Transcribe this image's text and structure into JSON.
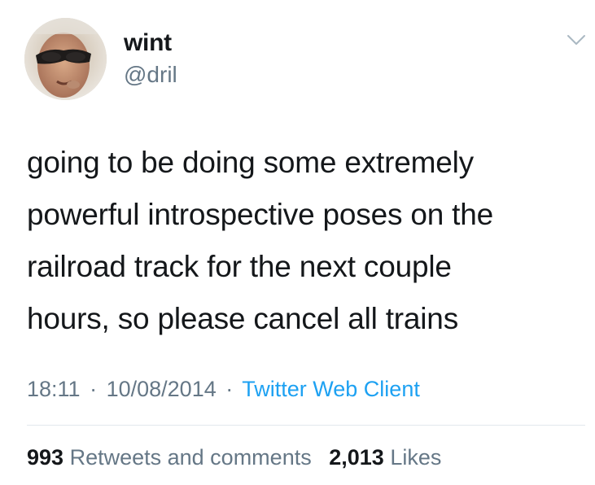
{
  "user": {
    "display_name": "wint",
    "handle": "@dril"
  },
  "tweet": {
    "lines": [
      "going to be doing some extremely",
      "powerful introspective poses on the",
      "railroad track for the next couple",
      "hours, so please cancel all trains"
    ],
    "time": "18:11",
    "date": "10/08/2014",
    "separator": "·",
    "source": "Twitter Web Client"
  },
  "stats": {
    "retweets_count": "993",
    "retweets_label": "Retweets and comments",
    "likes_count": "2,013",
    "likes_label": "Likes"
  },
  "icons": {
    "menu": "chevron-down-icon"
  },
  "colors": {
    "text": "#14171a",
    "secondary": "#657786",
    "link": "#1da1f2",
    "divider": "#e1e8ed"
  }
}
